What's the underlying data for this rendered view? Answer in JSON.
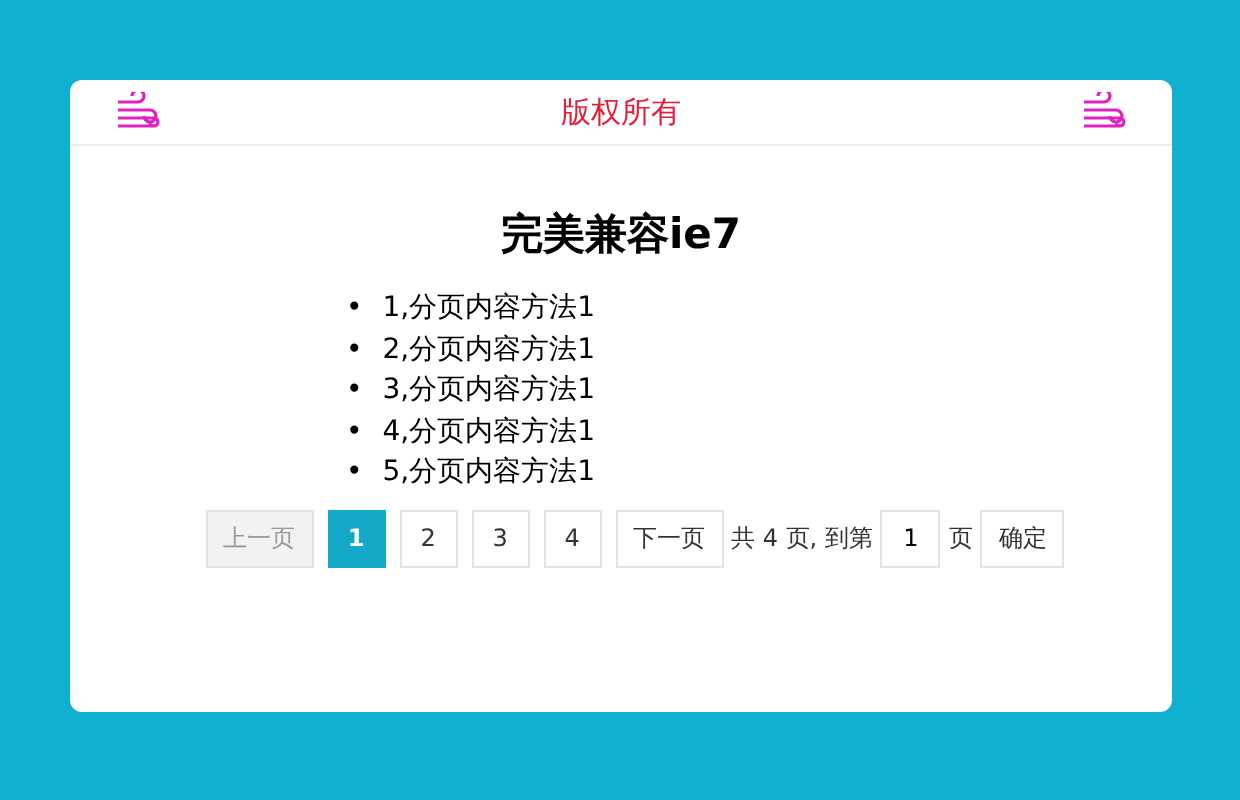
{
  "header": {
    "title": "版权所有"
  },
  "heading": "完美兼容ie7",
  "items": [
    {
      "marker": "•",
      "text": "1,分页内容方法1"
    },
    {
      "marker": "•",
      "text": "2,分页内容方法1"
    },
    {
      "marker": "•",
      "text": "3,分页内容方法1"
    },
    {
      "marker": "•",
      "text": "4,分页内容方法1"
    },
    {
      "marker": "•",
      "text": "5,分页内容方法1"
    }
  ],
  "pagination": {
    "prev": {
      "label": "上一页",
      "disabled": true
    },
    "pages": [
      {
        "label": "1",
        "selected": true
      },
      {
        "label": "2",
        "selected": false
      },
      {
        "label": "3",
        "selected": false
      },
      {
        "label": "4",
        "selected": false
      }
    ],
    "next": {
      "label": "下一页",
      "disabled": false
    },
    "total_text": "共 4 页, 到第",
    "goto_value": "1",
    "page_suffix": "页",
    "confirm": "确定"
  }
}
